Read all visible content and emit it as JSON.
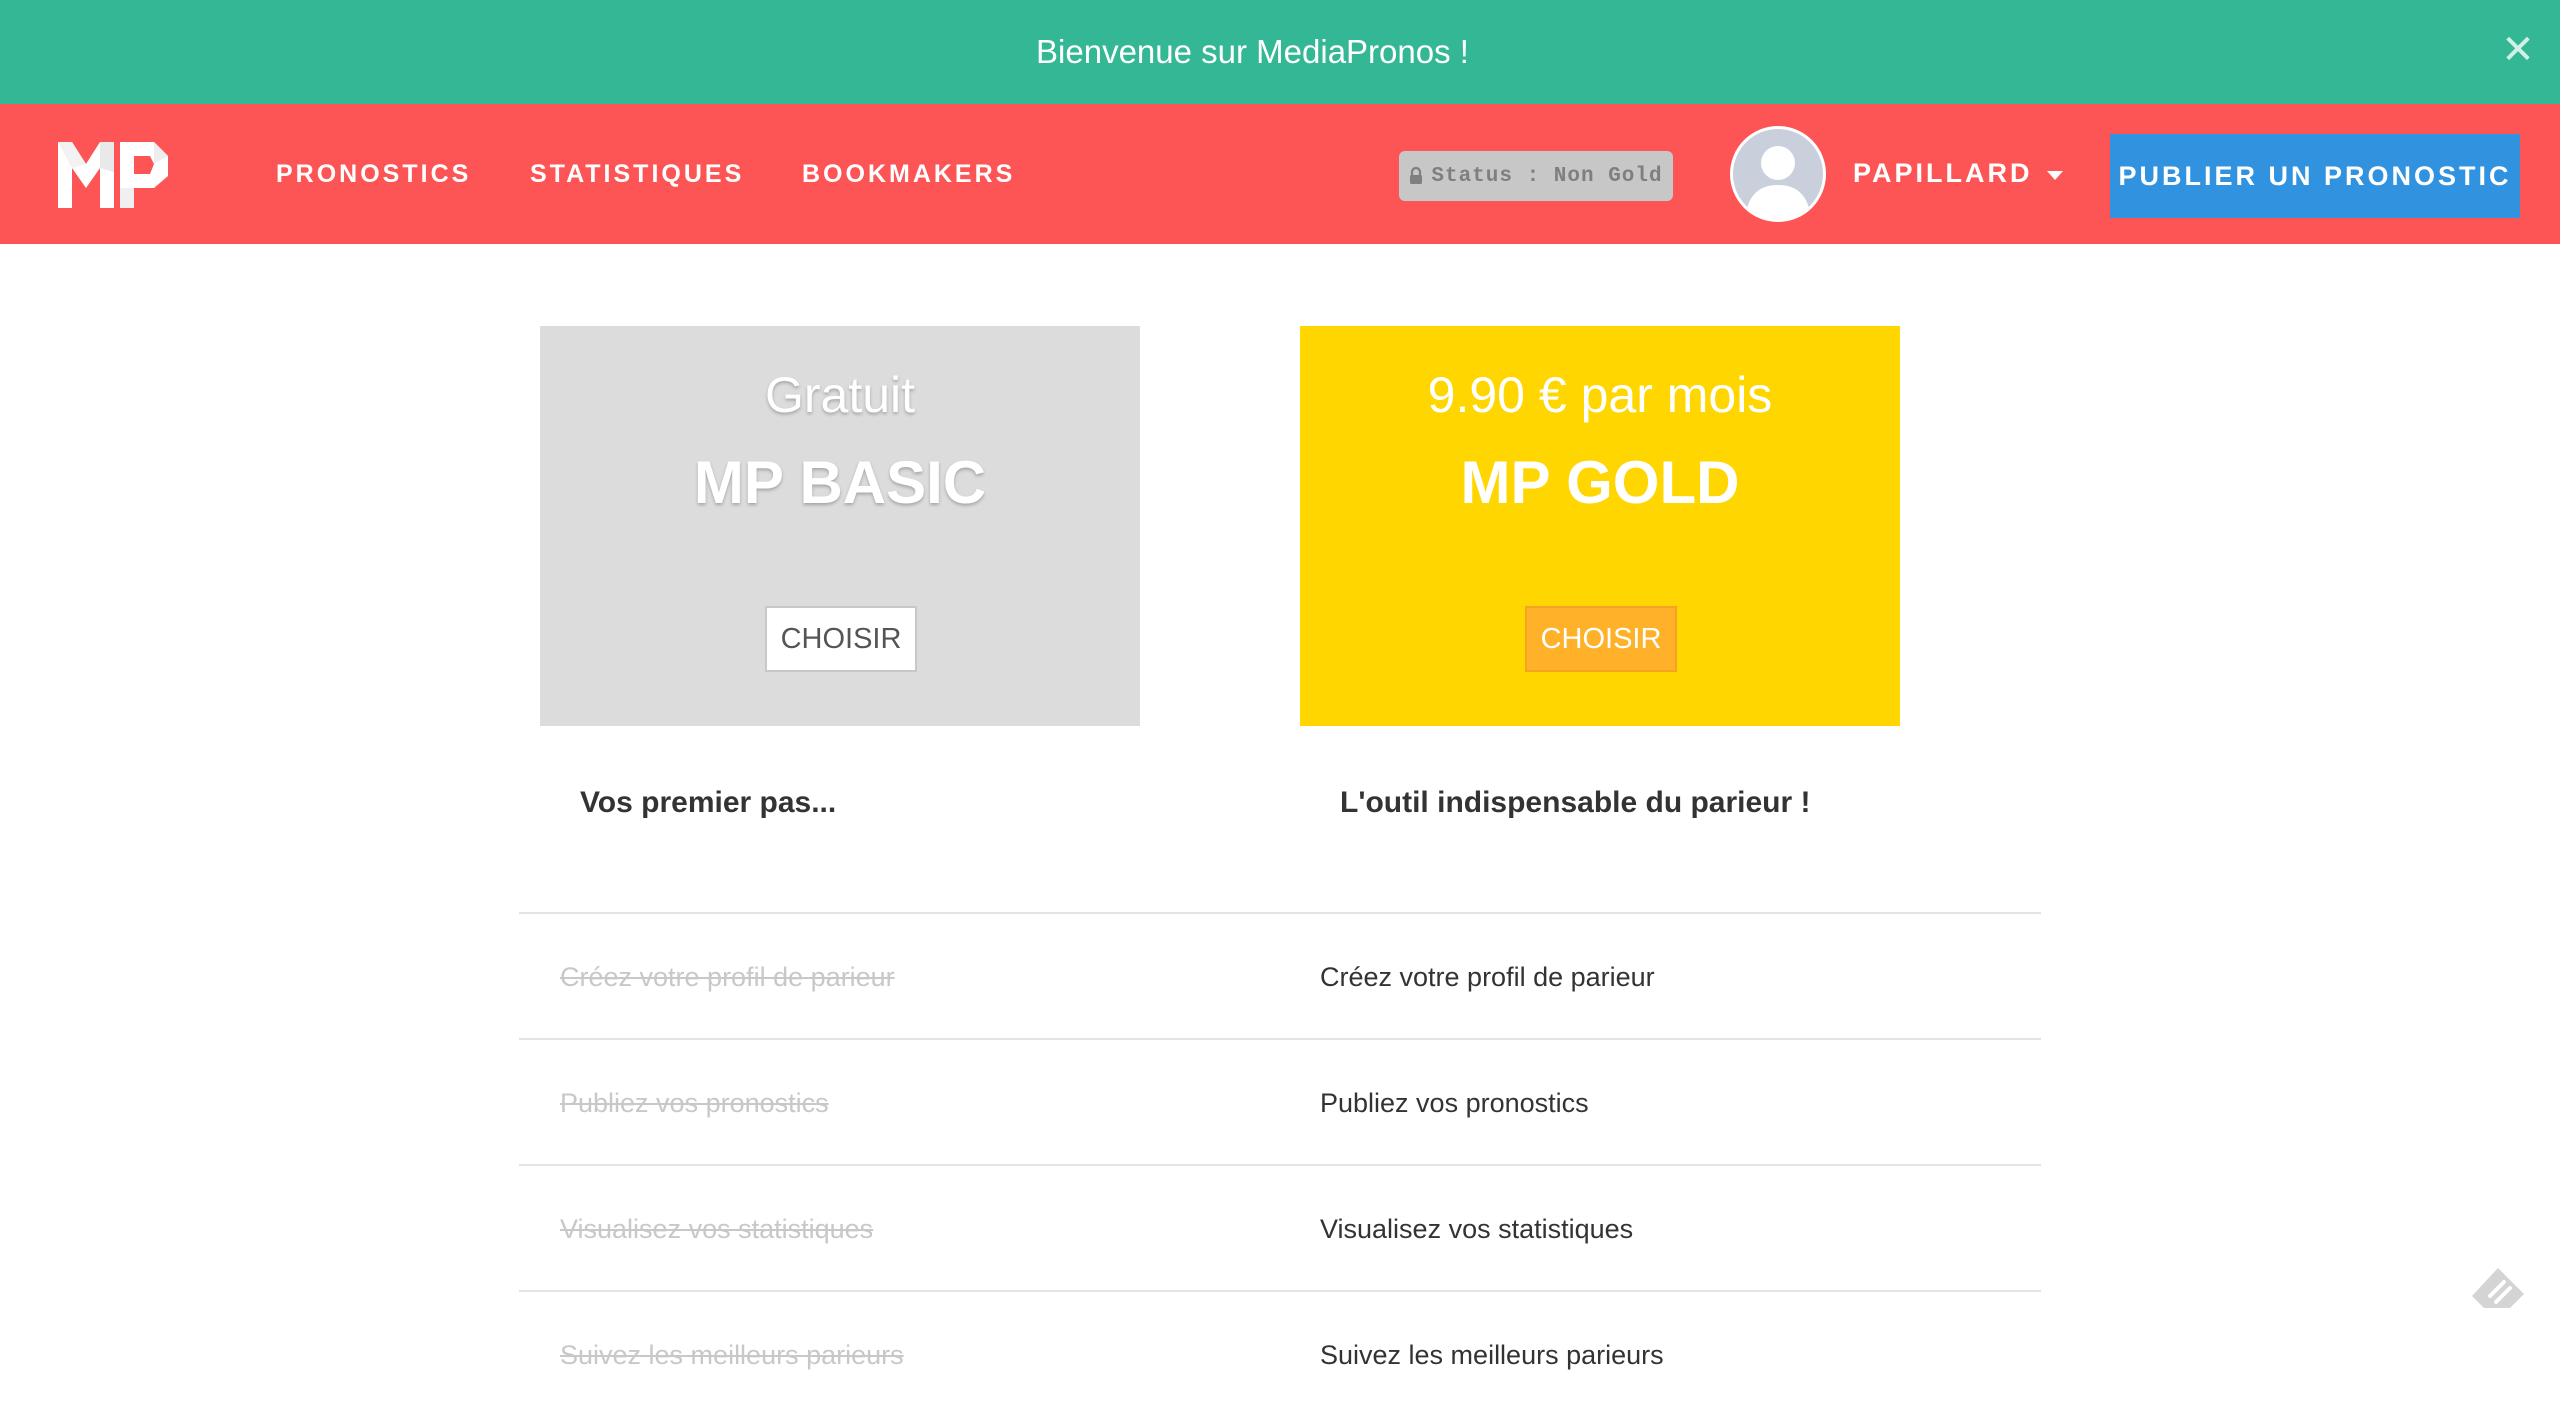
{
  "banner": {
    "text": "Bienvenue sur MediaPronos !",
    "close_icon": "close-icon",
    "color": "#33b795"
  },
  "navbar": {
    "color": "#fd5555",
    "logo_alt": "MP",
    "links": [
      {
        "label": "PRONOSTICS"
      },
      {
        "label": "STATISTIQUES"
      },
      {
        "label": "BOOKMAKERS"
      }
    ],
    "status_badge": "Status : Non Gold",
    "status_icon": "lock-icon",
    "user_name": "PAPILLARD",
    "user_menu_icon": "caret-down-icon",
    "publish_button": "PUBLIER UN PRONOSTIC",
    "publish_color": "#3193e0"
  },
  "plans": [
    {
      "price": "Gratuit",
      "name": "MP BASIC",
      "button": "CHOISIR",
      "tagline": "Vos premier pas...",
      "color": "#dcdcdc"
    },
    {
      "price": "9.90 € par mois",
      "name": "MP GOLD",
      "button": "CHOISIR",
      "tagline": "L'outil indispensable du parieur !",
      "color": "#ffd600"
    }
  ],
  "features": [
    {
      "basic": "Créez votre profil de parieur",
      "gold": "Créez votre profil de parieur"
    },
    {
      "basic": "Publiez vos pronostics",
      "gold": "Publiez vos pronostics"
    },
    {
      "basic": "Visualisez vos statistiques",
      "gold": "Visualisez vos statistiques"
    },
    {
      "basic": "Suivez les meilleurs parieurs",
      "gold": "Suivez les meilleurs parieurs"
    }
  ],
  "feedback_icon": "feedback-icon"
}
